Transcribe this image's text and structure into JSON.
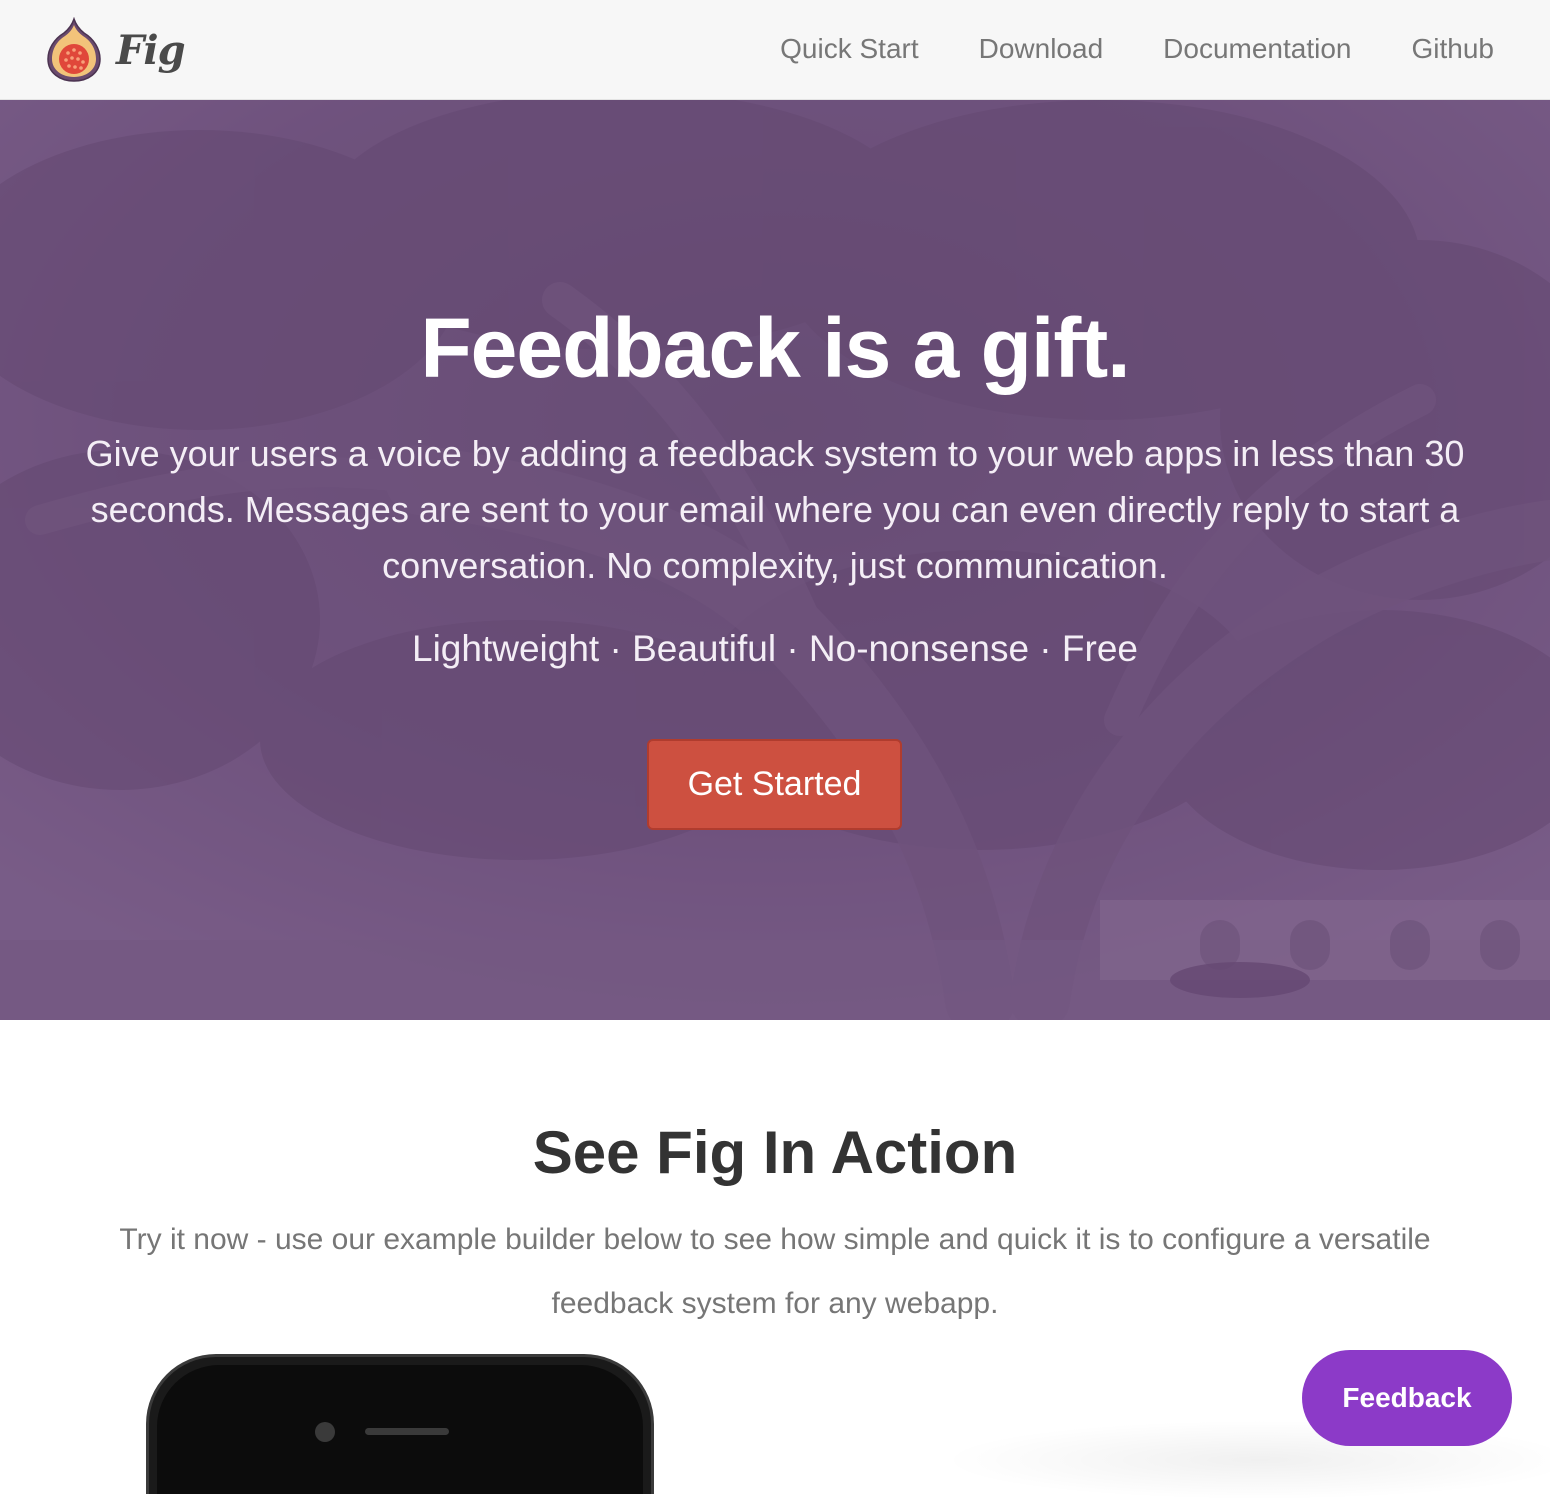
{
  "navbar": {
    "brand_name": "Fig",
    "links": [
      {
        "label": "Quick Start"
      },
      {
        "label": "Download"
      },
      {
        "label": "Documentation"
      },
      {
        "label": "Github"
      }
    ]
  },
  "hero": {
    "title": "Feedback is a gift.",
    "lead": "Give your users a voice by adding a feedback system to your web apps in less than 30 seconds. Messages are sent to your email where you can even directly reply to start a conversation. No complexity, just communication.",
    "tagline": "Lightweight · Beautiful · No-nonsense · Free",
    "cta_label": "Get Started"
  },
  "section": {
    "title": "See Fig In Action",
    "description": "Try it now - use our example builder below to see how simple and quick it is to configure a versatile feedback system for any webapp."
  },
  "widget": {
    "feedback_label": "Feedback"
  },
  "colors": {
    "hero_overlay": "#705082",
    "cta_background": "#cd5040",
    "feedback_button": "#8c3ac8",
    "navbar_background": "#f7f7f7"
  },
  "icons": {
    "logo": "fig-logo-icon"
  }
}
